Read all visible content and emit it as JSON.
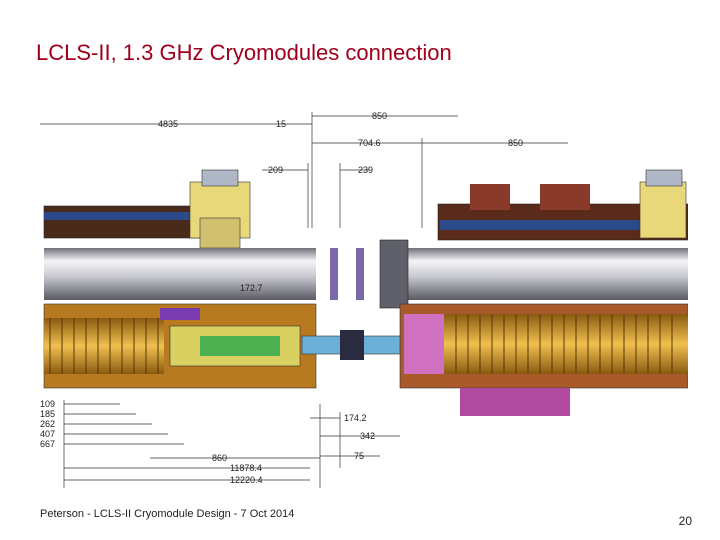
{
  "slide": {
    "title": "LCLS-II, 1.3 GHz Cryomodules connection",
    "footer": "Peterson - LCLS-II Cryomodule Design - 7 Oct 2014",
    "page_number": "20"
  },
  "dimensions": {
    "d4835": "4835",
    "d15": "15",
    "d850a": "850",
    "d704": "704.6",
    "d850b": "850",
    "d209": "209",
    "d239": "239",
    "d1727": "172.7",
    "d109": "109",
    "d185": "185",
    "d262": "262",
    "d407": "407",
    "d667": "667",
    "d1742": "174.2",
    "d342": "342",
    "d860": "860",
    "d75": "75",
    "d118784": "11878.4",
    "d122204": "12220.4"
  },
  "colors": {
    "title": "#a0001c",
    "cavity": "#d89a2a",
    "vessel_brown": "#8a4a2a",
    "purple": "#7a3cb0",
    "pipe": "#c8c8d0",
    "coupler_green": "#4caf50",
    "cyan": "#2ec4d6"
  }
}
